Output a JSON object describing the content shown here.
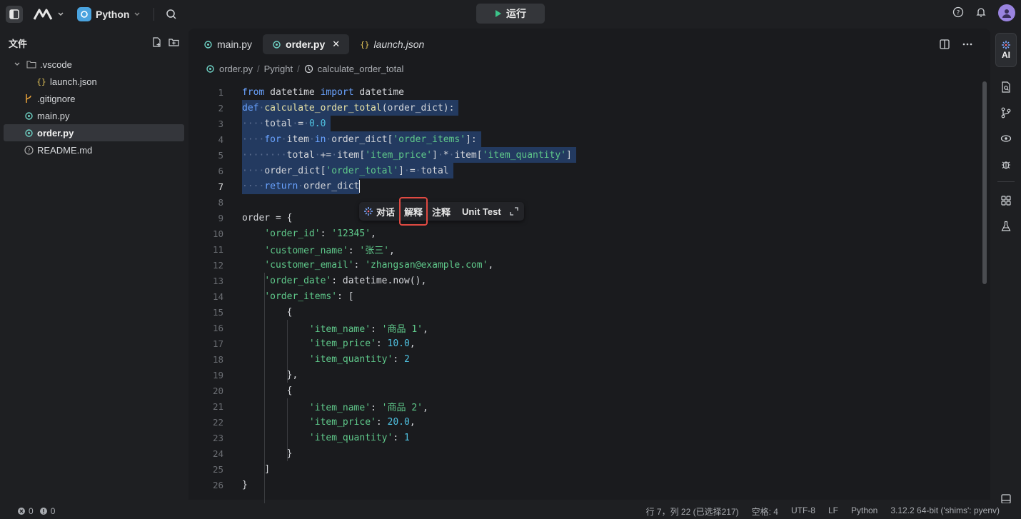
{
  "topbar": {
    "project_name": "Python",
    "run_label": "运行",
    "icons": [
      "sidebar-toggle-icon",
      "logo-icon",
      "search-icon",
      "help-icon",
      "bell-icon",
      "avatar"
    ]
  },
  "sidebar": {
    "title": "文件",
    "items": [
      {
        "label": ".vscode",
        "type": "folder"
      },
      {
        "label": "launch.json",
        "type": "json"
      },
      {
        "label": ".gitignore",
        "type": "git"
      },
      {
        "label": "main.py",
        "type": "python"
      },
      {
        "label": "order.py",
        "type": "python"
      },
      {
        "label": "README.md",
        "type": "readme"
      }
    ]
  },
  "tabs": [
    {
      "label": "main.py",
      "active": false
    },
    {
      "label": "order.py",
      "active": true
    },
    {
      "label": "launch.json",
      "active": false
    }
  ],
  "breadcrumb": {
    "file": "order.py",
    "analyzer": "Pyright",
    "symbol": "calculate_order_total"
  },
  "line_numbers": [
    "1",
    "2",
    "3",
    "4",
    "5",
    "6",
    "7",
    "8",
    "9",
    "10",
    "11",
    "12",
    "13",
    "14",
    "15",
    "16",
    "17",
    "18",
    "19",
    "20",
    "21",
    "22",
    "23",
    "24",
    "25",
    "26"
  ],
  "ai_bar": {
    "chat": "对话",
    "explain": "解释",
    "comment": "注释",
    "unit_test": "Unit Test"
  },
  "activity": {
    "ai_label": "AI"
  },
  "status": {
    "errors": "0",
    "warnings": "0",
    "position": "行 7，列 22 (已选择217)",
    "indent": "空格: 4",
    "encoding": "UTF-8",
    "eol": "LF",
    "language": "Python",
    "interpreter": "3.12.2 64-bit ('shims': pyenv)"
  },
  "colors": {
    "keyword": "#6aa3ff",
    "string": "#5fc88a",
    "number": "#4fc1e0",
    "selection": "#233a60",
    "highlight_box": "#e04a42"
  }
}
